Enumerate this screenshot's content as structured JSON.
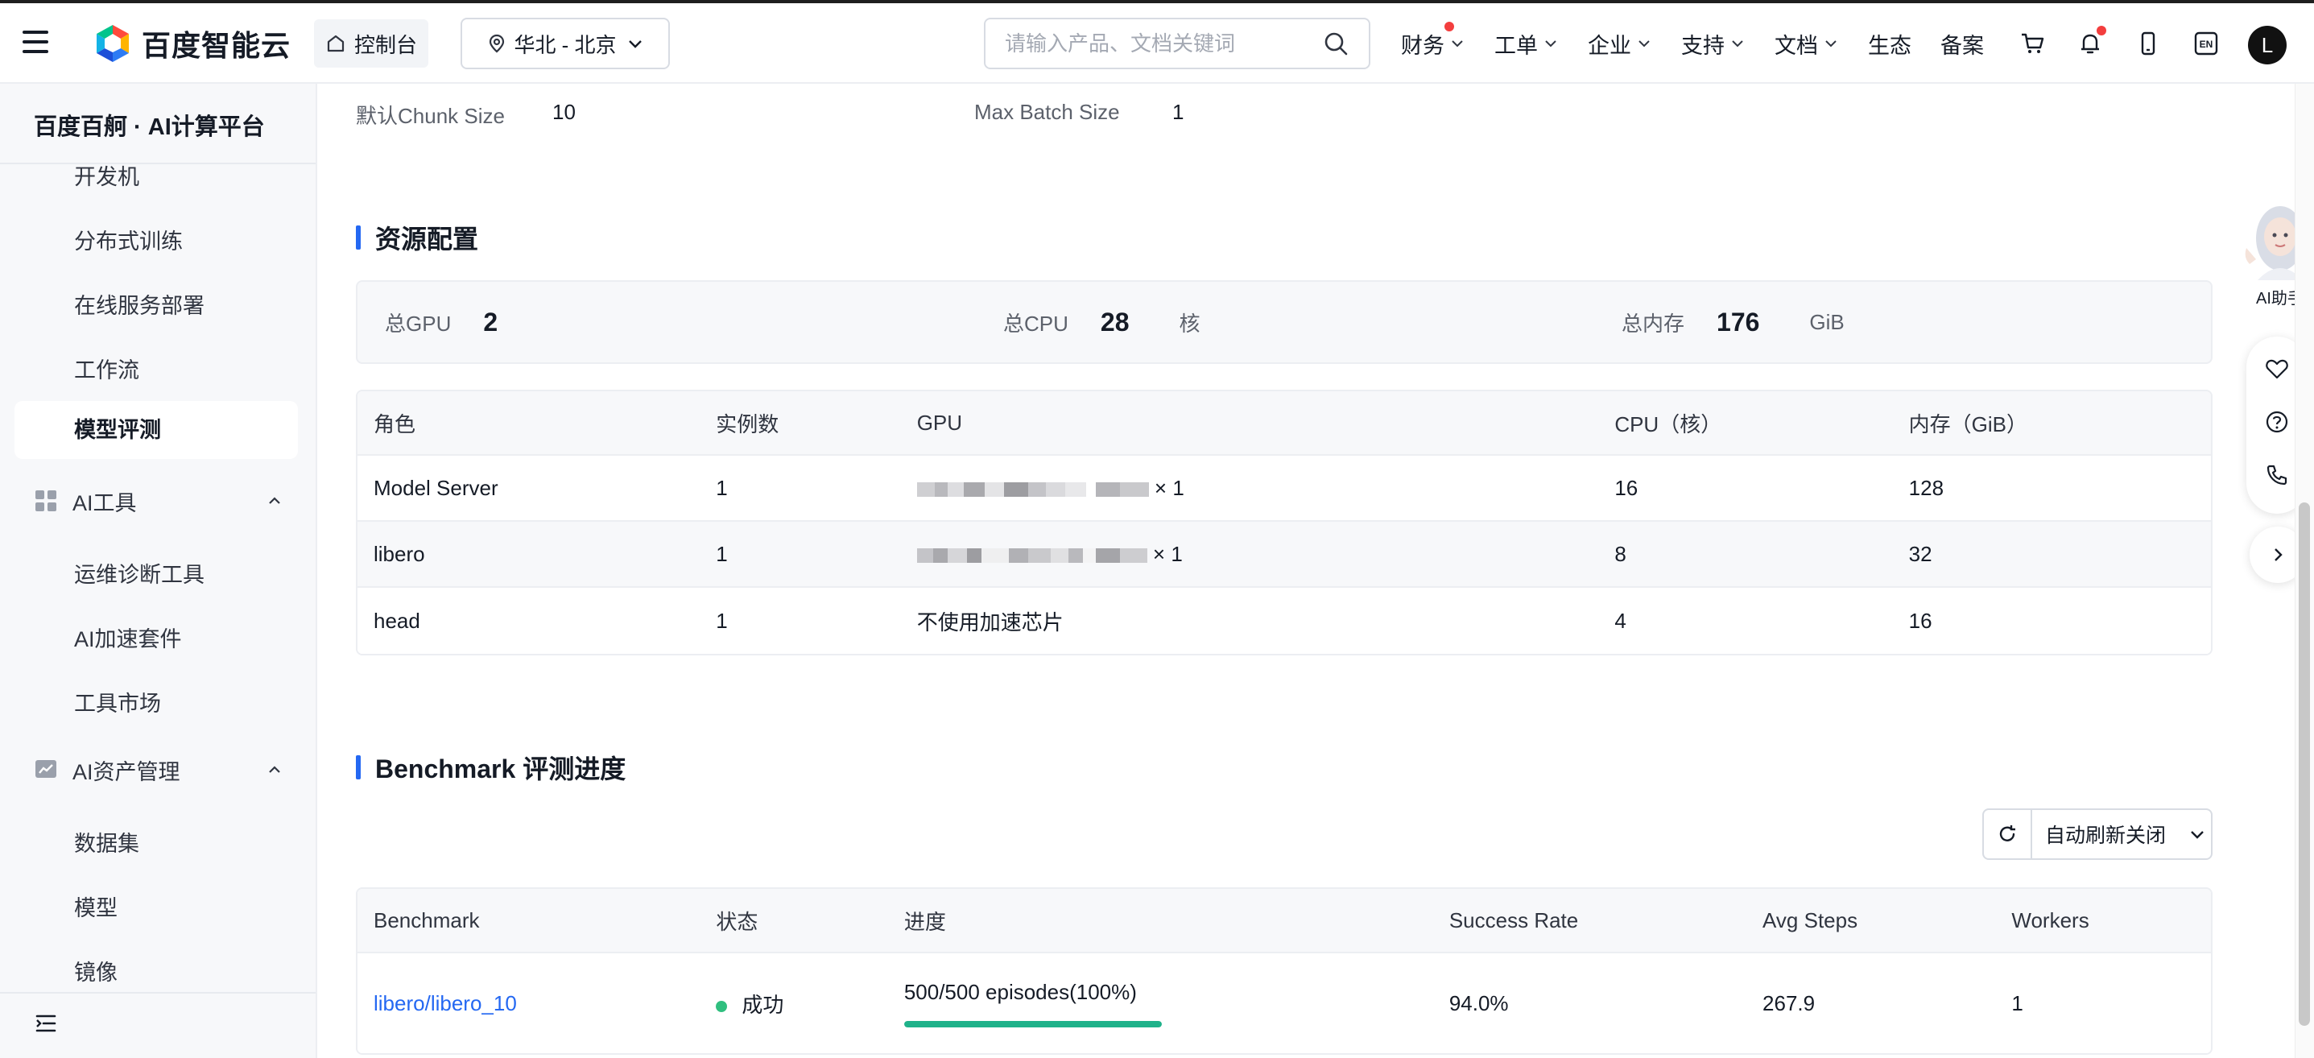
{
  "header": {
    "logo_text": "百度智能云",
    "console_label": "控制台",
    "region_label": "华北 - 北京",
    "search_placeholder": "请输入产品、文档关键词",
    "nav": [
      {
        "label": "财务",
        "dropdown": true,
        "dot": true
      },
      {
        "label": "工单",
        "dropdown": true
      },
      {
        "label": "企业",
        "dropdown": true
      },
      {
        "label": "支持",
        "dropdown": true
      },
      {
        "label": "文档",
        "dropdown": true
      },
      {
        "label": "生态",
        "dropdown": false
      },
      {
        "label": "备案",
        "dropdown": false
      }
    ],
    "icons": [
      "cart-icon",
      "bell-icon",
      "phone-icon",
      "language-icon"
    ],
    "lang_badge": "EN",
    "avatar_letter": "L"
  },
  "sidebar": {
    "title": "百度百舸 · AI计算平台",
    "items": [
      {
        "label": "开发机"
      },
      {
        "label": "分布式训练"
      },
      {
        "label": "在线服务部署"
      },
      {
        "label": "工作流"
      },
      {
        "label": "模型评测",
        "active": true
      }
    ],
    "group_ai_tools": {
      "label": "AI工具",
      "items": [
        "运维诊断工具",
        "AI加速套件",
        "工具市场"
      ]
    },
    "group_ai_assets": {
      "label": "AI资产管理",
      "items": [
        "数据集",
        "模型",
        "镜像"
      ]
    }
  },
  "config": {
    "chunk_label": "默认Chunk Size",
    "chunk_value": "10",
    "batch_label": "Max Batch Size",
    "batch_value": "1"
  },
  "resources": {
    "title": "资源配置",
    "summary": {
      "gpu_label": "总GPU",
      "gpu_value": "2",
      "cpu_label": "总CPU",
      "cpu_value": "28",
      "cpu_unit": "核",
      "mem_label": "总内存",
      "mem_value": "176",
      "mem_unit": "GiB"
    },
    "columns": [
      "角色",
      "实例数",
      "GPU",
      "CPU（核）",
      "内存（GiB）"
    ],
    "rows": [
      {
        "role": "Model Server",
        "instances": "1",
        "gpu": "× 1",
        "cpu": "16",
        "mem": "128"
      },
      {
        "role": "libero",
        "instances": "1",
        "gpu": "× 1",
        "cpu": "8",
        "mem": "32"
      },
      {
        "role": "head",
        "instances": "1",
        "gpu": "不使用加速芯片",
        "cpu": "4",
        "mem": "16"
      }
    ]
  },
  "benchmark": {
    "title": "Benchmark 评测进度",
    "auto_refresh_label": "自动刷新关闭",
    "columns": [
      "Benchmark",
      "状态",
      "进度",
      "Success Rate",
      "Avg Steps",
      "Workers"
    ],
    "rows": [
      {
        "name": "libero/libero_10",
        "status": "成功",
        "progress_text": "500/500 episodes(100%)",
        "progress": 1.0,
        "success_rate": "94.0%",
        "avg_steps": "267.9",
        "workers": "1"
      }
    ]
  },
  "floating": {
    "ai_helper_label": "AI助手"
  },
  "colors": {
    "accent": "#2468f2",
    "success": "#30bf7f",
    "progress": "#1fb28a",
    "alert_dot": "#f33e3e"
  }
}
